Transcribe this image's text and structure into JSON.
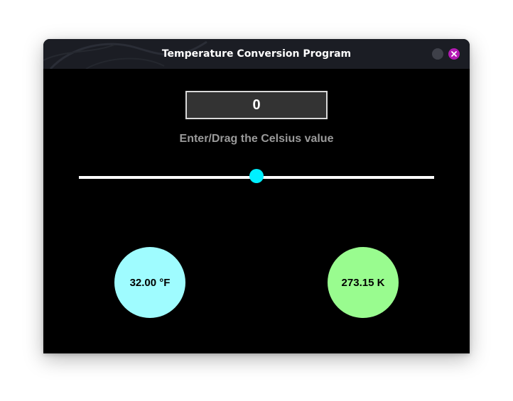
{
  "window": {
    "title": "Temperature Conversion Program"
  },
  "celsius": {
    "value": "0",
    "prompt": "Enter/Drag the Celsius value"
  },
  "slider": {
    "position_fraction": 0.5
  },
  "fahrenheit": {
    "text": "32.00 °F",
    "color": "#9ffcff"
  },
  "kelvin": {
    "text": "273.15 K",
    "color": "#99fc8f"
  },
  "icons": {
    "minimize": "minimize-icon",
    "close": "close-icon"
  },
  "colors": {
    "titlebar": "#1b1d24",
    "close_button": "#b31ab3",
    "slider_handle": "#00f0ff"
  }
}
